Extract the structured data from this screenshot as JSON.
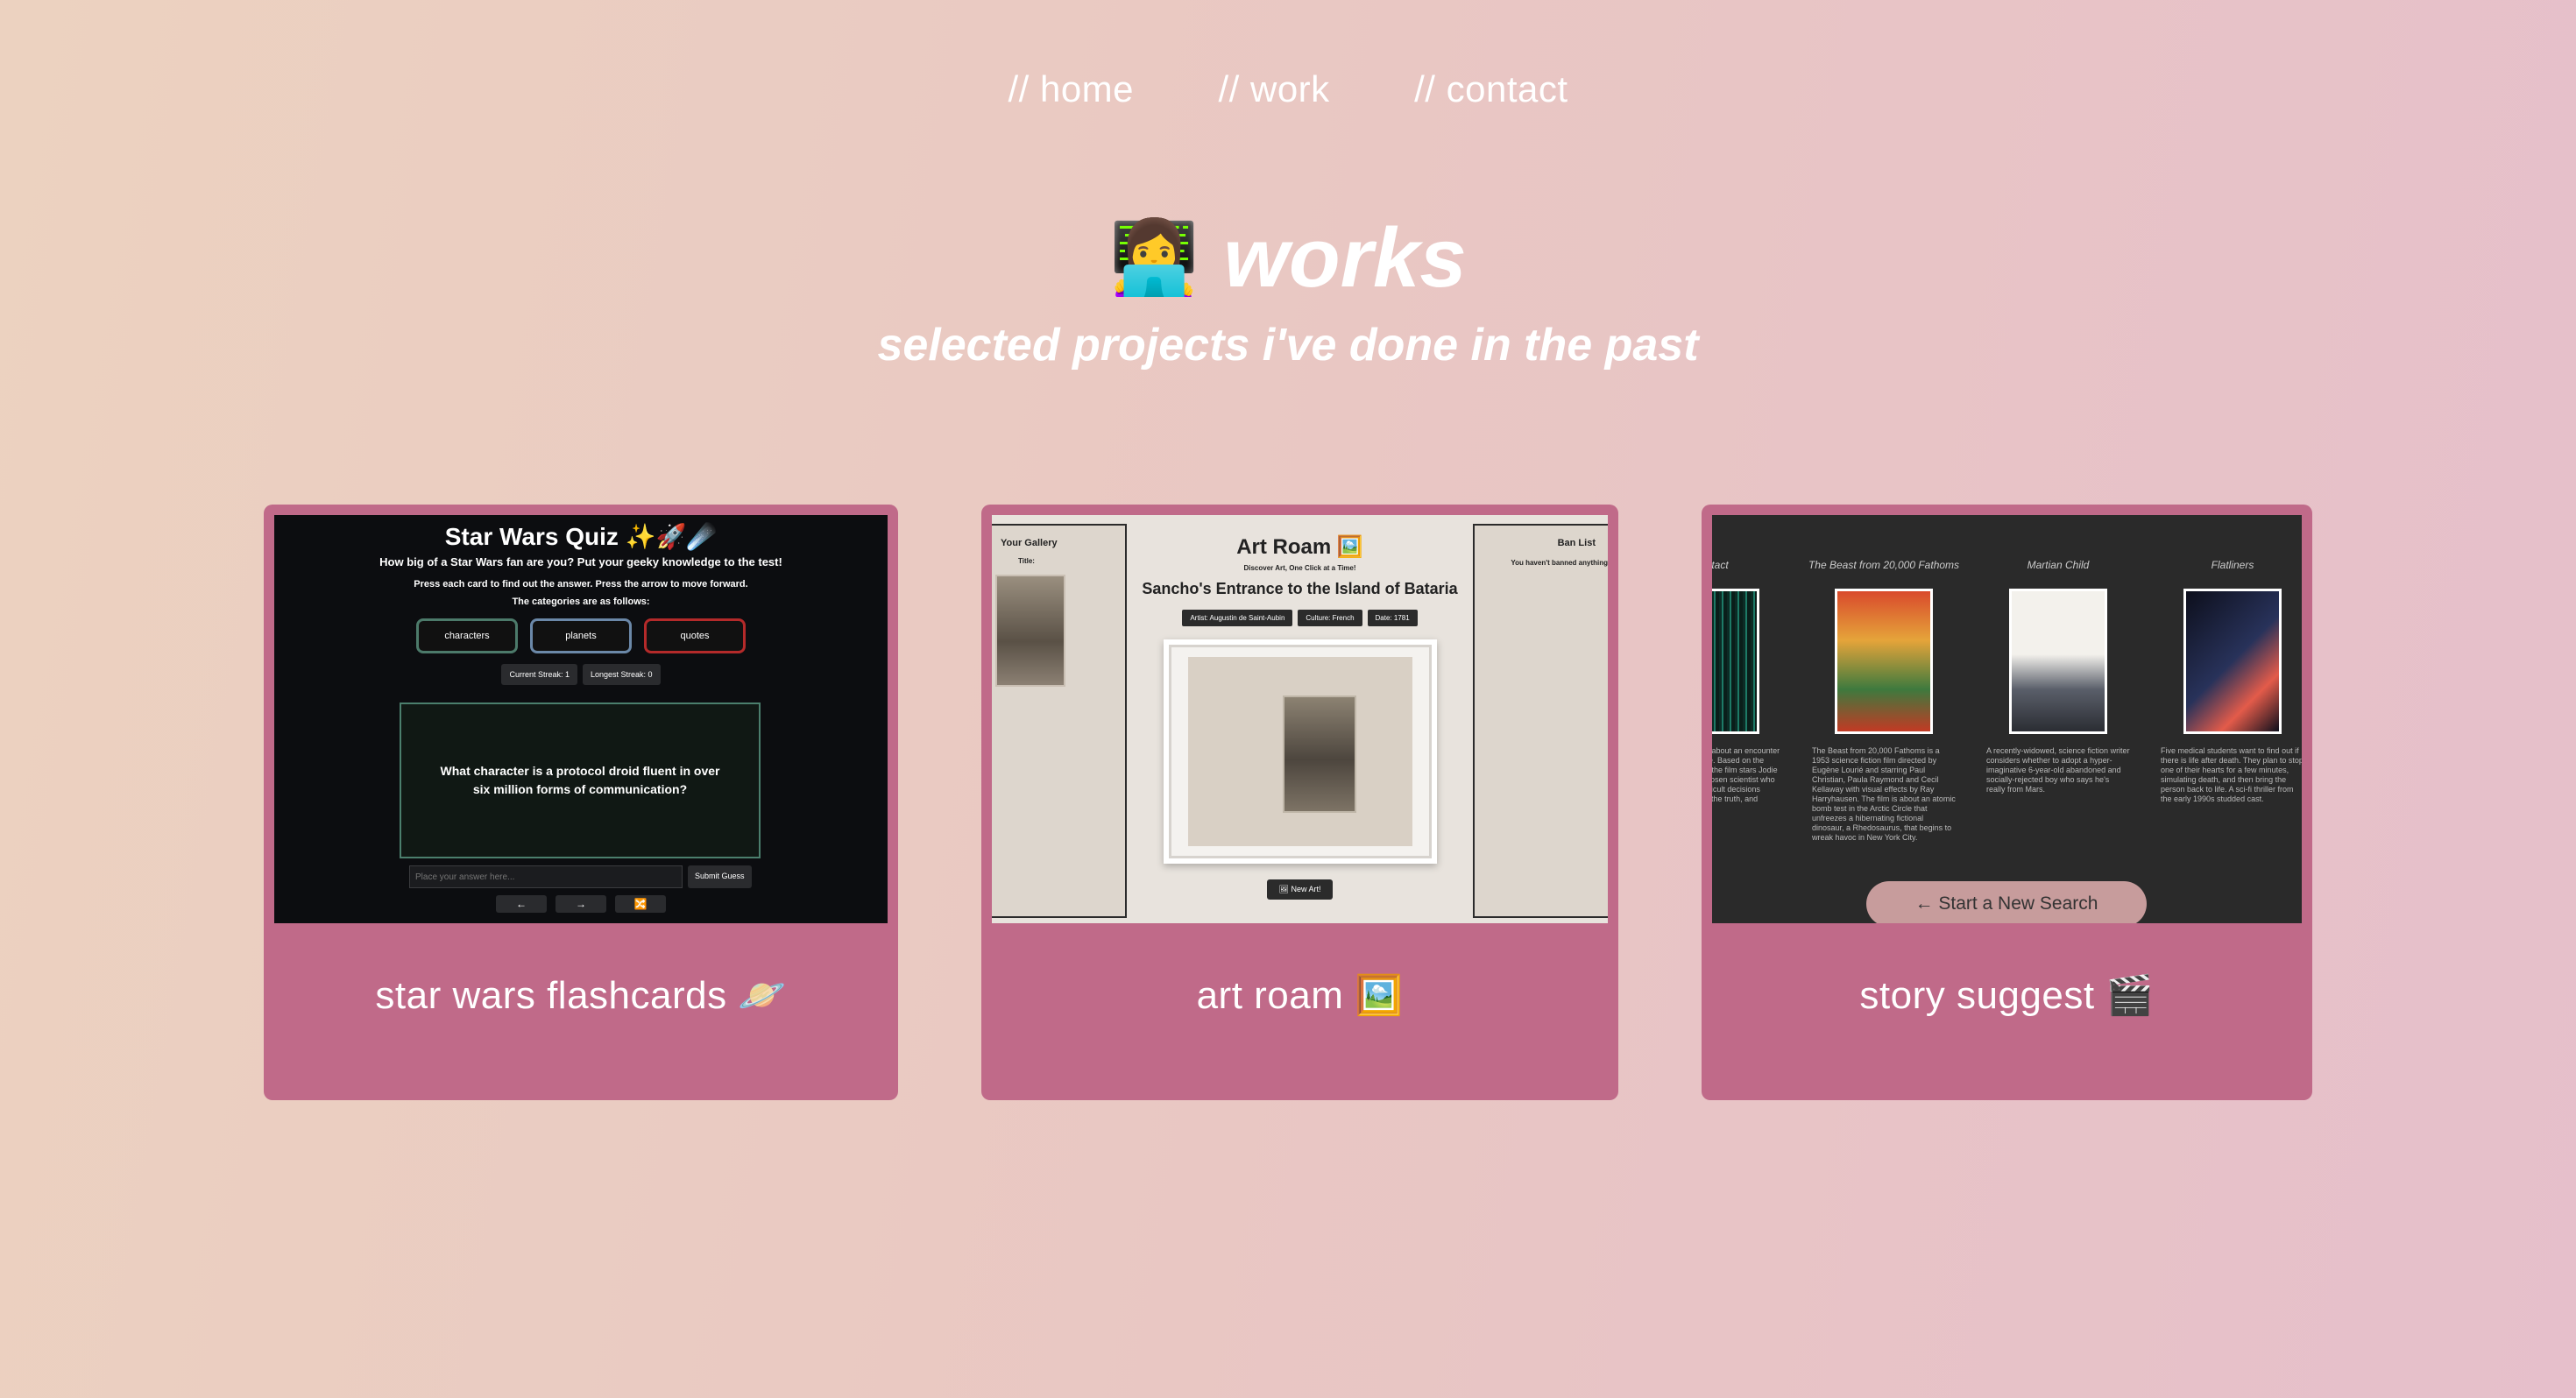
{
  "nav": {
    "home": "// home",
    "work": "// work",
    "contact": "// contact"
  },
  "heading": {
    "emoji": "👩‍💻",
    "title": "works",
    "subtitle": "selected projects i've done in the past"
  },
  "projects": [
    {
      "label": "star wars flashcards 🪐",
      "screenshot": {
        "title": "Star Wars Quiz ✨🚀☄️",
        "subtitle": "How big of a Star Wars fan are you? Put your geeky knowledge to the test!",
        "instructions": "Press each card to find out the answer. Press the arrow to move forward.",
        "categories_label": "The categories are as follows:",
        "categories": [
          "characters",
          "planets",
          "quotes"
        ],
        "current_streak": "Current Streak: 1",
        "longest_streak": "Longest Streak: 0",
        "question": "What character is a protocol droid fluent in over six million forms of communication?",
        "input_placeholder": "Place your answer here...",
        "submit_label": "Submit Guess",
        "prev_label": "←",
        "next_label": "→",
        "shuffle_label": "🔀"
      }
    },
    {
      "label": "art roam 🖼️",
      "screenshot": {
        "gallery_title": "Your Gallery",
        "gallery_item_label": "Title:",
        "ban_title": "Ban List",
        "ban_empty": "You haven't banned anything",
        "title": "Art Roam 🖼️",
        "tagline": "Discover Art, One Click at a Time!",
        "artwork_title": "Sancho's Entrance to the Island of Bataria",
        "chips": [
          "Artist: Augustin de Saint-Aubin",
          "Culture: French",
          "Date: 1781"
        ],
        "new_art_label": "🖼 New Art!"
      }
    },
    {
      "label": "story suggest 🎬",
      "screenshot": {
        "movies": [
          {
            "name": "Contact",
            "description": "A science fiction film about an encounter with alien intelligence. Based on the novel by Carl Sagan the film stars Jodie Foster as the one chosen scientist who must make some difficult decisions between her beliefs, the truth, and reality."
          },
          {
            "name": "The Beast from 20,000 Fathoms",
            "description": "The Beast from 20,000 Fathoms is a 1953 science fiction film directed by Eugène Lourié and starring Paul Christian, Paula Raymond and Cecil Kellaway with visual effects by Ray Harryhausen. The film is about an atomic bomb test in the Arctic Circle that unfreezes a hibernating fictional dinosaur, a Rhedosaurus, that begins to wreak havoc in New York City."
          },
          {
            "name": "Martian Child",
            "description": "A recently-widowed, science fiction writer considers whether to adopt a hyper-imaginative 6-year-old abandoned and socially-rejected boy who says he's really from Mars."
          },
          {
            "name": "Flatliners",
            "description": "Five medical students want to find out if there is life after death. They plan to stop one of their hearts for a few minutes, simulating death, and then bring the person back to life. A sci-fi thriller from the early 1990s studded cast."
          }
        ],
        "new_search_label": "← Start a New Search"
      }
    }
  ]
}
